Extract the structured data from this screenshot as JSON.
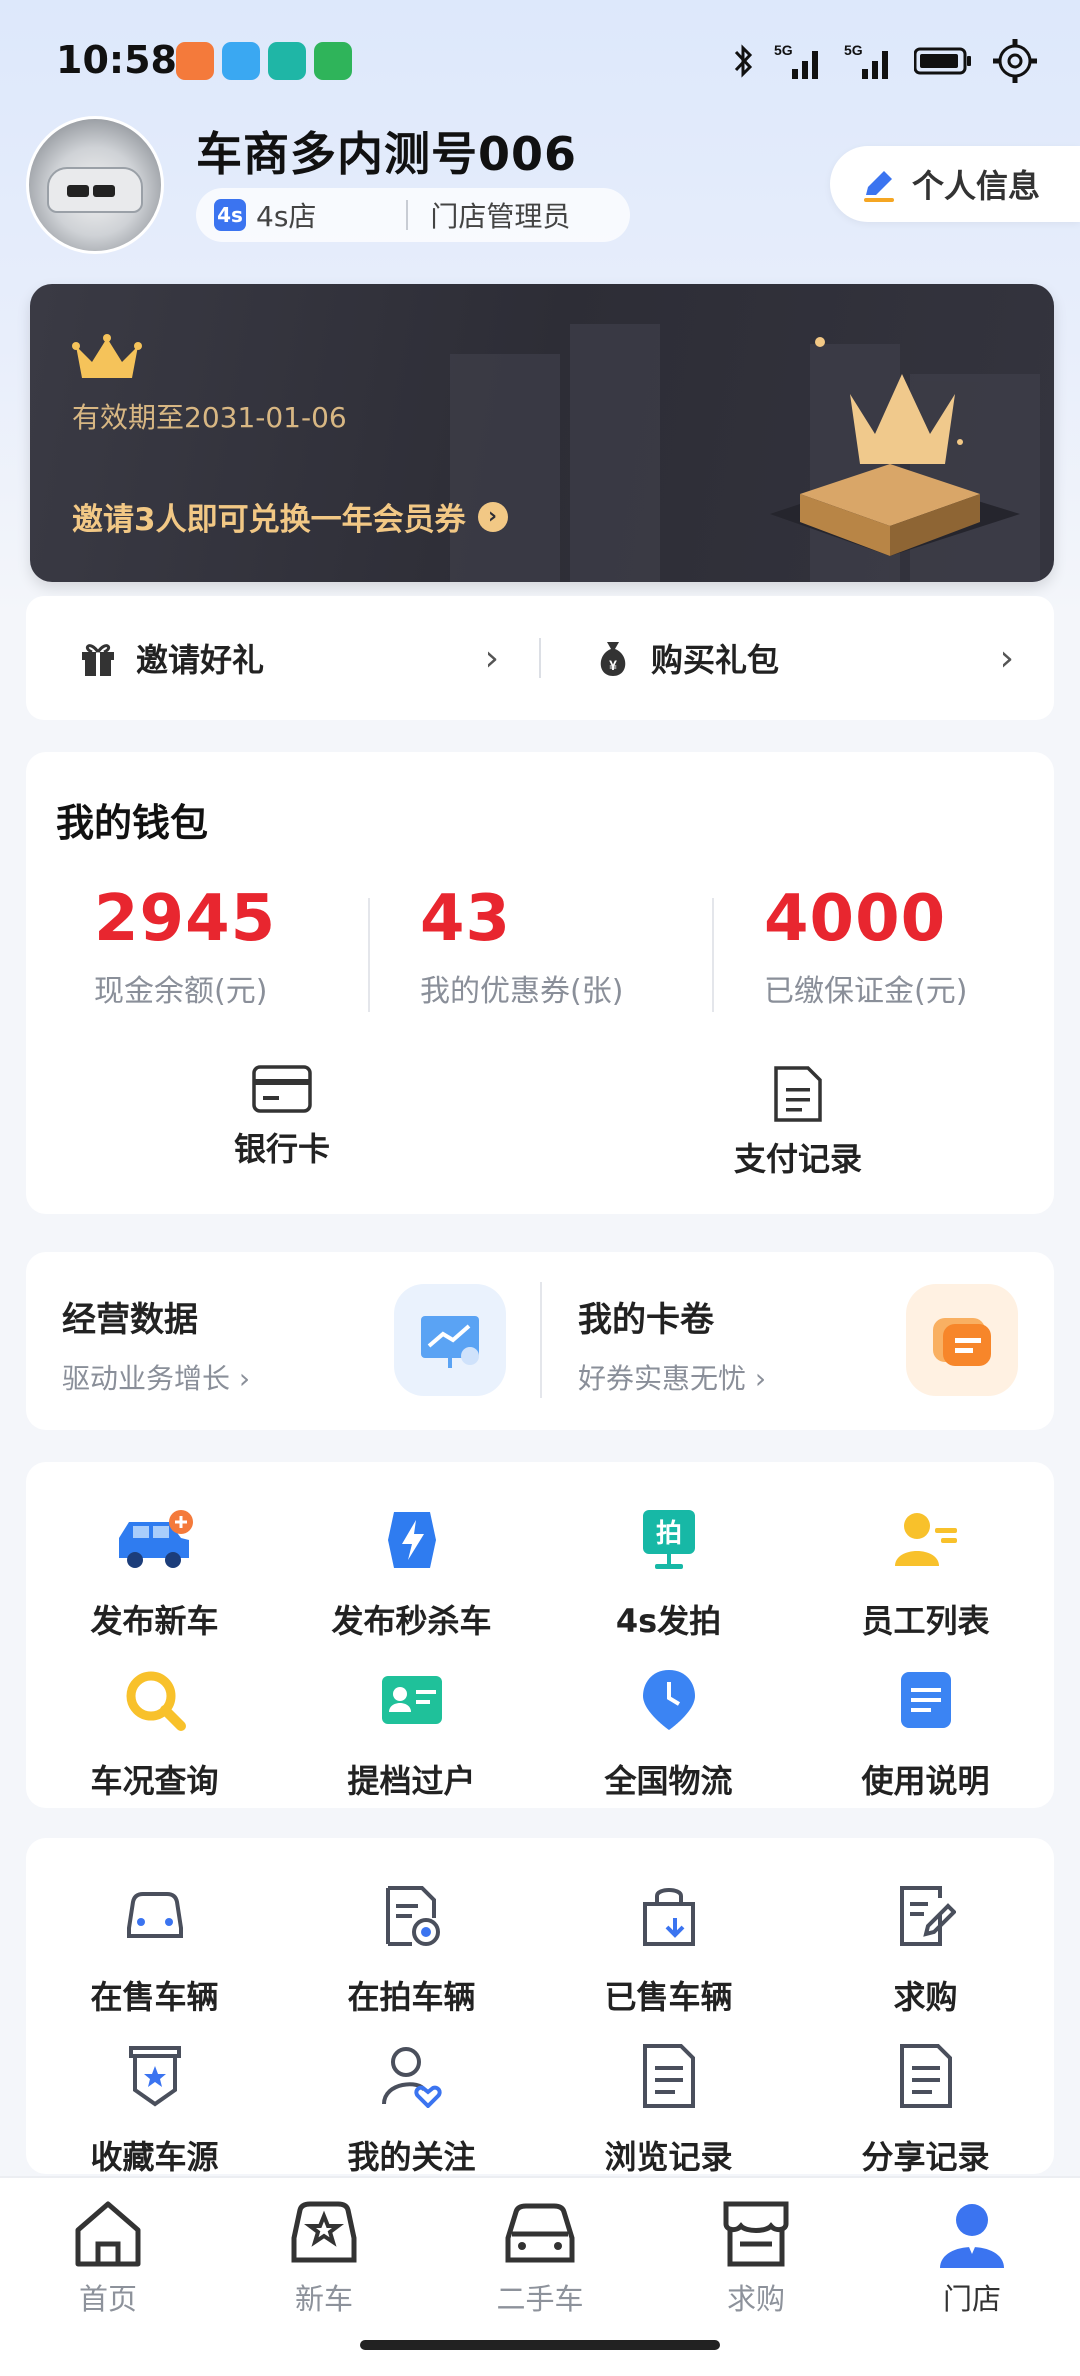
{
  "status_bar": {
    "time": "10:58"
  },
  "profile": {
    "name": "车商多内测号006",
    "badge": "4s",
    "store_type": "4s店",
    "role": "门店管理员",
    "info_button": "个人信息"
  },
  "vip": {
    "expire_text": "有效期至2031-01-06",
    "invite_text": "邀请3人即可兑换一年会员券"
  },
  "gifts": {
    "invite_label": "邀请好礼",
    "package_label": "购买礼包"
  },
  "wallet": {
    "title": "我的钱包",
    "stats": [
      {
        "value": "2945",
        "label": "现金余额(元)"
      },
      {
        "value": "43",
        "label": "我的优惠券(张)"
      },
      {
        "value": "4000",
        "label": "已缴保证金(元)"
      }
    ],
    "actions": [
      {
        "label": "银行卡"
      },
      {
        "label": "支付记录"
      }
    ]
  },
  "ops": [
    {
      "title": "经营数据",
      "subtitle": "驱动业务增长"
    },
    {
      "title": "我的卡卷",
      "subtitle": "好券实惠无忧"
    }
  ],
  "tools": [
    {
      "label": "发布新车",
      "icon": "new-car-plus-icon"
    },
    {
      "label": "发布秒杀车",
      "icon": "lightning-icon"
    },
    {
      "label": "4s发拍",
      "icon": "auction-icon"
    },
    {
      "label": "员工列表",
      "icon": "staff-icon"
    },
    {
      "label": "车况查询",
      "icon": "magnifier-icon"
    },
    {
      "label": "提档过户",
      "icon": "id-card-icon"
    },
    {
      "label": "全国物流",
      "icon": "location-pin-icon"
    },
    {
      "label": "使用说明",
      "icon": "document-icon"
    }
  ],
  "records": [
    {
      "label": "在售车辆",
      "icon": "car-front-icon"
    },
    {
      "label": "在拍车辆",
      "icon": "auction-doc-icon"
    },
    {
      "label": "已售车辆",
      "icon": "shopping-bag-icon"
    },
    {
      "label": "求购",
      "icon": "edit-doc-icon"
    },
    {
      "label": "收藏车源",
      "icon": "star-badge-icon"
    },
    {
      "label": "我的关注",
      "icon": "user-heart-icon"
    },
    {
      "label": "浏览记录",
      "icon": "list-doc-icon"
    },
    {
      "label": "分享记录",
      "icon": "list-doc-icon"
    }
  ],
  "tabs": [
    {
      "label": "首页",
      "icon": "home-icon"
    },
    {
      "label": "新车",
      "icon": "new-car-icon"
    },
    {
      "label": "二手车",
      "icon": "used-car-icon"
    },
    {
      "label": "求购",
      "icon": "store-icon"
    },
    {
      "label": "门店",
      "icon": "user-icon"
    }
  ],
  "colors": {
    "accent_red": "#e8262f",
    "accent_blue": "#3b74f0",
    "vip_gold": "#f2c885"
  }
}
